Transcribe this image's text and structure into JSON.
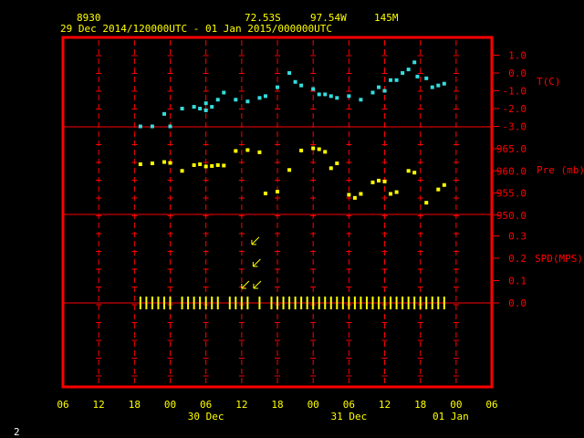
{
  "header": {
    "station_id": "8930",
    "latitude": "72.53S",
    "longitude": "97.54W",
    "elevation": "145M",
    "time_range": "29 Dec 2014/120000UTC - 01 Jan 2015/000000UTC"
  },
  "page_number": "2",
  "colors": {
    "frame": "#ff0000",
    "grid": "#ff0000",
    "temperature": "#33dddd",
    "pressure": "#ffff00",
    "wind": "#ffff00",
    "axis_text": "#ffff00"
  },
  "chart_data": [
    {
      "type": "scatter",
      "series": [
        {
          "name": "T(C)",
          "x": [
            13,
            15,
            17,
            18,
            20,
            22,
            23,
            24,
            24,
            25,
            26,
            27,
            29,
            31,
            33,
            34,
            36,
            38,
            39,
            40,
            42,
            43,
            44,
            45,
            46,
            48,
            50,
            52,
            53,
            54,
            55,
            56,
            57,
            58,
            59,
            59.5,
            61,
            62,
            63,
            64
          ],
          "y": [
            -3.0,
            -3.0,
            -2.3,
            -3.0,
            -2.0,
            -1.9,
            -2.0,
            -1.7,
            -2.1,
            -1.9,
            -1.5,
            -1.1,
            -1.5,
            -1.6,
            -1.4,
            -1.3,
            -0.8,
            0.0,
            -0.5,
            -0.7,
            -0.9,
            -1.2,
            -1.2,
            -1.3,
            -1.4,
            -1.3,
            -1.5,
            -1.1,
            -0.8,
            -1.0,
            -0.4,
            -0.4,
            0.0,
            0.2,
            0.6,
            -0.2,
            -0.3,
            -0.8,
            -0.7,
            -0.6
          ]
        }
      ],
      "yticks": [
        1.0,
        0.0,
        -1.0,
        -2.0,
        -3.0
      ],
      "tick_labels": [
        "1.0",
        "0.0",
        "-1.0",
        "-2.0",
        "-3.0"
      ],
      "ylabel": "T(C)",
      "ylim": [
        -3.0,
        1.5
      ]
    },
    {
      "type": "scatter",
      "series": [
        {
          "name": "Pre (mb)",
          "x": [
            13,
            15,
            17,
            18,
            20,
            22,
            23,
            24,
            25,
            26,
            27,
            29,
            31,
            33,
            34,
            36,
            38,
            40,
            42,
            43,
            44,
            45,
            46,
            48,
            49,
            50,
            52,
            53,
            54,
            55,
            56,
            58,
            59,
            61,
            63,
            64
          ],
          "y": [
            961.5,
            961.7,
            962.0,
            961.8,
            960.0,
            961.3,
            961.5,
            961.0,
            961.1,
            961.3,
            961.2,
            964.5,
            964.7,
            964.2,
            954.9,
            955.3,
            960.2,
            964.6,
            965.1,
            964.9,
            964.3,
            960.6,
            961.7,
            954.6,
            953.9,
            954.8,
            957.4,
            957.8,
            957.6,
            954.8,
            955.2,
            960.0,
            959.6,
            952.8,
            955.8,
            956.8
          ]
        }
      ],
      "yticks": [
        965.0,
        960.0,
        955.0,
        950.0
      ],
      "tick_labels": [
        "965.0",
        "960.0",
        "955.0",
        "950.0"
      ],
      "ylabel": "Pre (mb)",
      "ylim": [
        950,
        970
      ]
    },
    {
      "type": "scatter",
      "series": [
        {
          "name": "SPD(MPS)",
          "x": [
            13,
            14,
            15,
            16,
            17,
            18,
            20,
            21,
            22,
            23,
            24,
            25,
            26,
            28,
            29,
            30,
            31,
            32,
            33,
            35,
            36,
            37,
            38,
            39,
            40,
            41,
            42,
            43,
            44,
            45,
            46,
            47,
            48,
            49,
            50,
            51,
            52,
            53,
            54,
            55,
            56,
            57,
            58,
            59,
            60,
            61,
            62,
            63,
            64
          ],
          "y": [
            0,
            0,
            0,
            0,
            0,
            0,
            0,
            0,
            0,
            0,
            0,
            0,
            0,
            0,
            0,
            0,
            0,
            0.27,
            0,
            0,
            0,
            0,
            0,
            0,
            0,
            0,
            0,
            0,
            0,
            0,
            0,
            0,
            0,
            0,
            0,
            0,
            0,
            0,
            0,
            0,
            0,
            0,
            0,
            0,
            0,
            0,
            0,
            0,
            0
          ]
        }
      ],
      "yticks": [
        0.3,
        0.2,
        0.1,
        0.0
      ],
      "tick_labels": [
        "0.3",
        "0.2",
        "0.1",
        "0.0"
      ],
      "ylabel": "SPD(MPS)",
      "ylim": [
        0,
        0.35
      ]
    }
  ],
  "x_axis": {
    "tick_labels": [
      "06",
      "12",
      "18",
      "00",
      "06",
      "12",
      "18",
      "00",
      "06",
      "12",
      "18",
      "00",
      "06"
    ],
    "day_labels": [
      "30 Dec",
      "31 Dec",
      "01 Jan"
    ]
  }
}
